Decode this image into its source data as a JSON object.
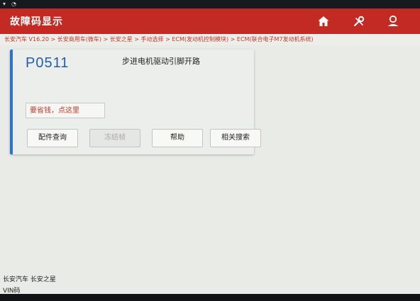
{
  "status_bar": {
    "icons": [
      "signal-icon",
      "wifi-icon"
    ]
  },
  "title_bar": {
    "title": "故障码显示",
    "buttons": [
      "home-icon",
      "tools-icon",
      "user-icon"
    ]
  },
  "breadcrumb": "长安汽车 V16.20 > 长安商用车(微车) > 长安之星 > 手动选择 > ECM(发动机控制模块) > ECM(联合电子M7发动机系统)",
  "dtc_card": {
    "code": "P0511",
    "description": "步进电机驱动引脚开路",
    "promo_label": "要省钱，点这里",
    "actions": [
      {
        "label": "配件查询",
        "enabled": true
      },
      {
        "label": "冻结帧",
        "enabled": false
      },
      {
        "label": "帮助",
        "enabled": true
      },
      {
        "label": "相关搜索",
        "enabled": true
      }
    ]
  },
  "vehicle_info": {
    "model": "长安汽车 长安之星",
    "vin_label": "VIN码"
  },
  "colors": {
    "title_bar": "#c42a24",
    "accent_blue": "#2c73c9",
    "breadcrumb_text": "#c0392b"
  }
}
